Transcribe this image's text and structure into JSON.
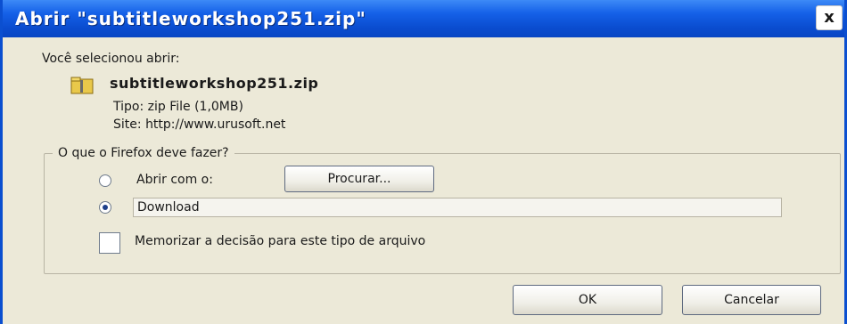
{
  "window": {
    "title": "Abrir \"subtitleworkshop251.zip\"",
    "close_label": "x"
  },
  "intro_text": "Você selecionou abrir:",
  "file": {
    "name": "subtitleworkshop251.zip",
    "icon": "zip-folder-icon",
    "type_label": "Tipo: zip File (1,0MB)",
    "site_label": "Site:",
    "site_url": "http://www.urusoft.net"
  },
  "action_group": {
    "legend": "O que o Firefox deve fazer?",
    "open_with": {
      "label": "Abrir com o:",
      "selected": false,
      "browse_button": "Procurar..."
    },
    "download": {
      "label": "Download",
      "selected": true
    },
    "remember": {
      "label": "Memorizar a decisão para este tipo de arquivo",
      "checked": false
    }
  },
  "buttons": {
    "ok": "OK",
    "cancel": "Cancelar"
  }
}
